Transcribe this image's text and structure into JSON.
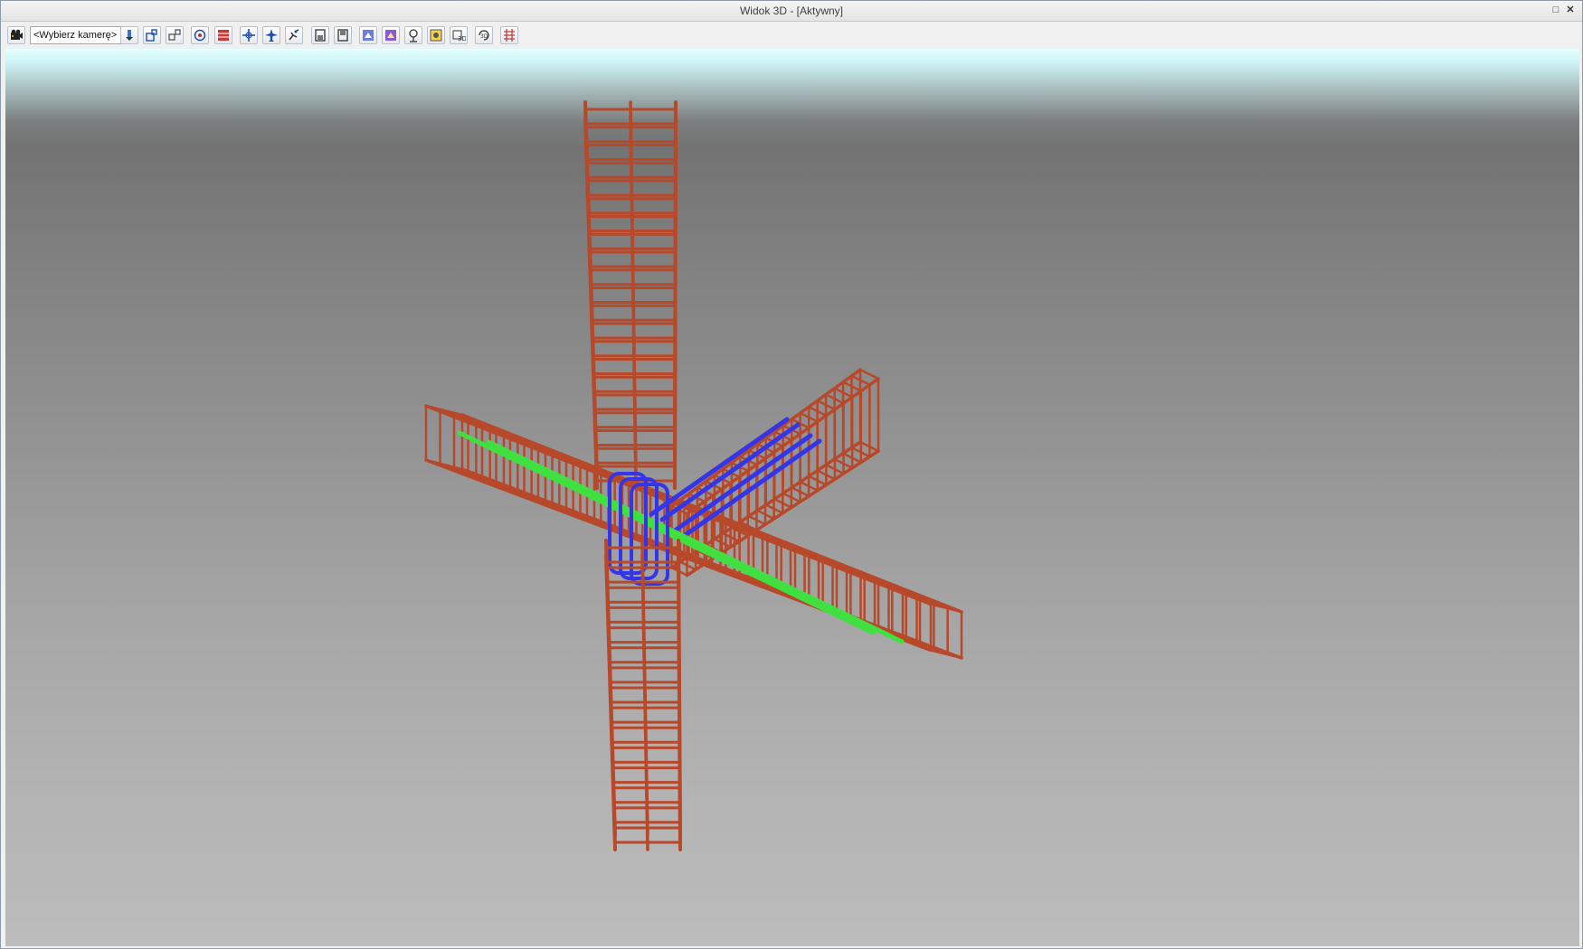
{
  "window": {
    "title": "Widok 3D - [Aktywny]",
    "restore_glyph": "□",
    "close_glyph": "✕"
  },
  "toolbar": {
    "camera_select": {
      "value": "<Wybierz kamerę>"
    },
    "buttons": [
      "camera-icon",
      "camera-dropdown-icon",
      "zoom-window-icon",
      "zoom-extents-icon",
      "orbit-icon",
      "section-icon",
      "pan-icon",
      "fly-icon",
      "walk-icon",
      "view-save-icon",
      "view-load-icon",
      "render-icon",
      "render-settings-icon",
      "light-icon",
      "background-icon",
      "export-3d-icon",
      "rotate-3d-icon",
      "grid-icon"
    ]
  },
  "viewport": {
    "scene": "reinforcement cage column-beam junction",
    "colors": {
      "rebar_stirrup": "#b8482a",
      "rebar_longitudinal_beam_a": "#3fe03f",
      "rebar_longitudinal_beam_b": "#3535e8",
      "background_top": "#e6feff",
      "background_horizon": "#737373",
      "background_bottom": "#bcbcbc"
    }
  }
}
